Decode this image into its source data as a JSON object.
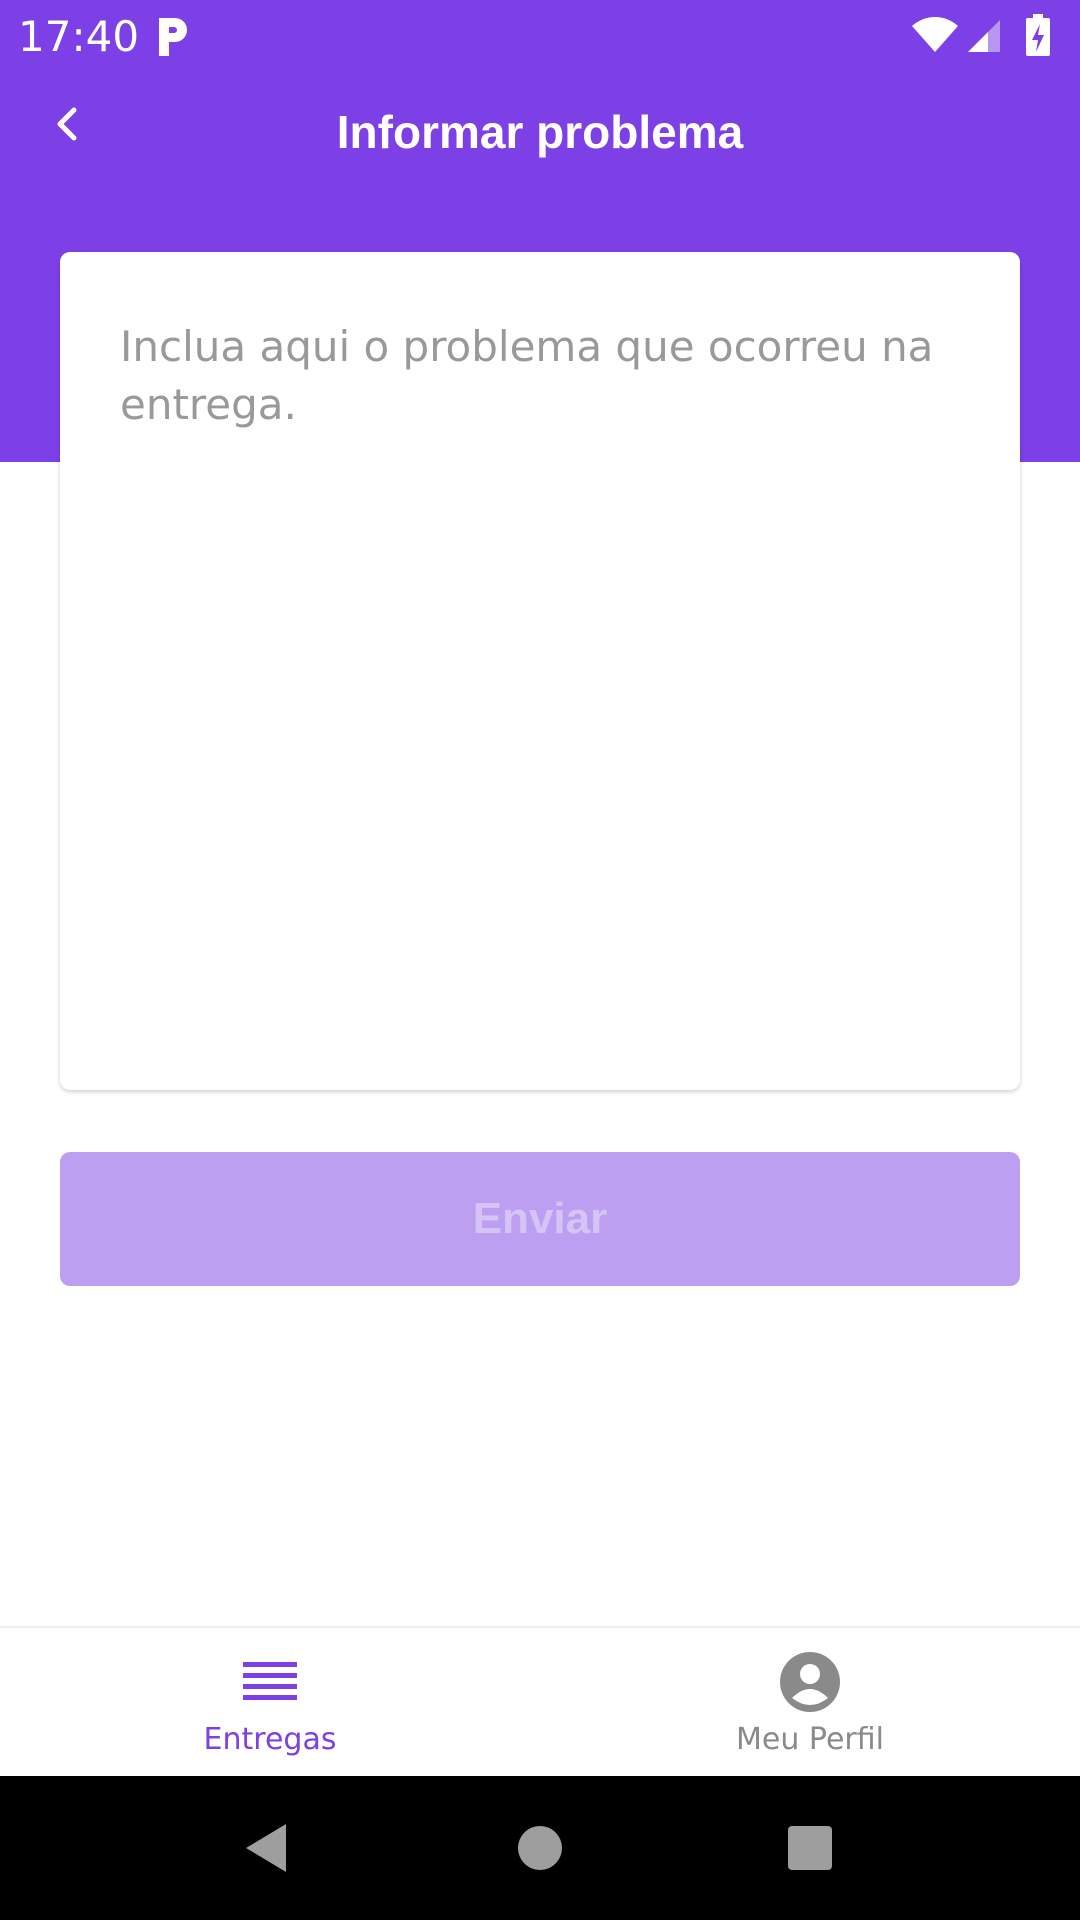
{
  "status_bar": {
    "time": "17:40",
    "icons": [
      "app-p-icon",
      "wifi-icon",
      "signal-icon",
      "battery-charging-icon"
    ]
  },
  "header": {
    "title": "Informar problema",
    "back_icon": "chevron-left-icon"
  },
  "problem_form": {
    "placeholder": "Inclua aqui o problema que ocorreu na entrega.",
    "value": "",
    "submit_label": "Enviar",
    "submit_state": "disabled"
  },
  "bottom_nav": {
    "items": [
      {
        "label": "Entregas",
        "icon": "list-icon",
        "active": true
      },
      {
        "label": "Meu Perfil",
        "icon": "account-circle-icon",
        "active": false
      }
    ]
  },
  "system_nav": {
    "buttons": [
      "back-triangle-icon",
      "home-circle-icon",
      "recents-square-icon"
    ]
  },
  "colors": {
    "primary": "#7d40e7",
    "disabled_button": "#bd9ff1",
    "disabled_text": "#d6c4f6",
    "inactive_nav": "#8a8a8a",
    "placeholder": "#999999"
  }
}
